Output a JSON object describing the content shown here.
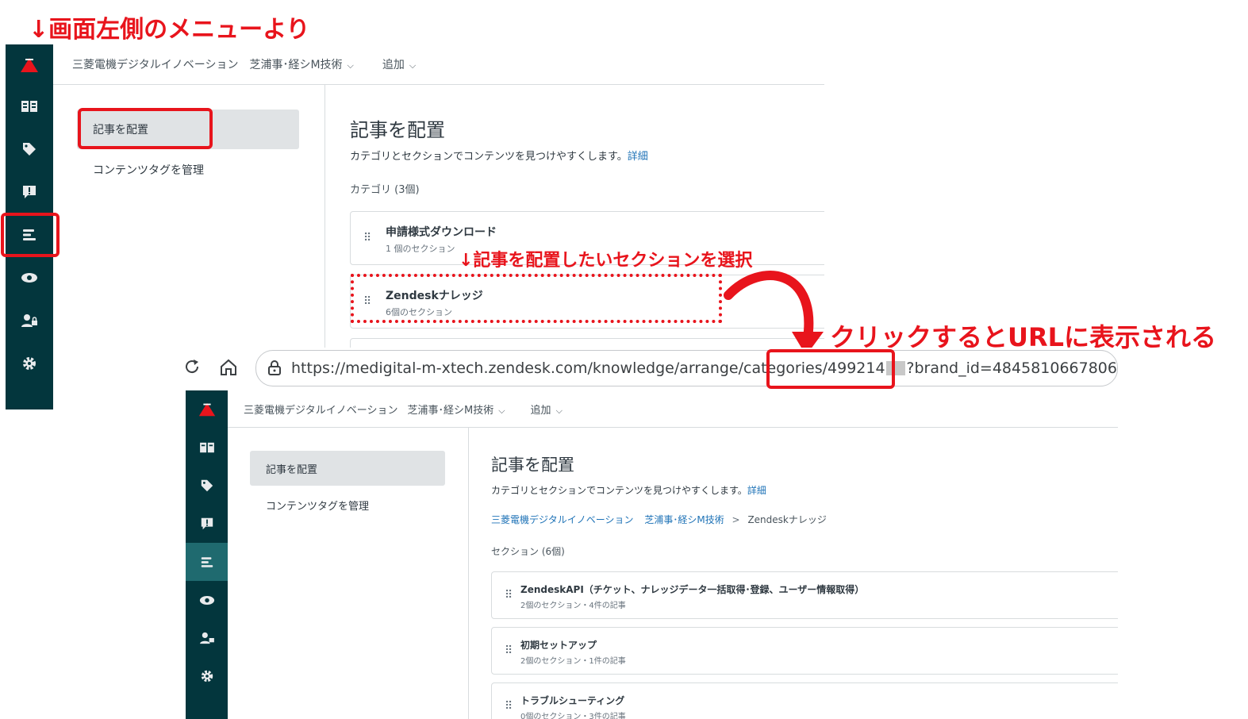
{
  "annotations": {
    "top_left": "↓画面左側のメニューより",
    "select_section": "↓記事を配置したいセクションを選択",
    "click_url": "クリックするとURLに表示される"
  },
  "header": {
    "brand": "三菱電機デジタルイノベーション",
    "workspace": "芝浦事･経シM技術",
    "add": "追加"
  },
  "sidebar_icons": [
    "knowledge-icon",
    "tag-icon",
    "feedback-icon",
    "arrange-icon",
    "eye-icon",
    "user-permissions-icon",
    "settings-icon"
  ],
  "subnav": {
    "arrange": "記事を配置",
    "tags": "コンテンツタグを管理"
  },
  "page": {
    "title": "記事を配置",
    "description": "カテゴリとセクションでコンテンツを見つけやすくします。",
    "details_link": "詳細"
  },
  "categories": {
    "label": "カテゴリ (3個)",
    "items": [
      {
        "title": "申請様式ダウンロード",
        "sub": "1 個のセクション"
      },
      {
        "title": "Zendeskナレッジ",
        "sub": "6個のセクション"
      }
    ]
  },
  "browser": {
    "url_before": "https://medigital-m-xtech.zendesk.com/knowledge/arrange/categories",
    "url_id": "/499214",
    "url_after": "?brand_id=4845810667806"
  },
  "breadcrumb": {
    "brand": "三菱電機デジタルイノベーション",
    "workspace": "芝浦事･経シM技術",
    "sep": ">",
    "current": "Zendeskナレッジ"
  },
  "sections": {
    "label": "セクション (6個)",
    "items": [
      {
        "title": "ZendeskAPI（チケット、ナレッジデータ一括取得･登録、ユーザー情報取得）",
        "sub": "2個のセクション・4件の記事"
      },
      {
        "title": "初期セットアップ",
        "sub": "2個のセクション・1件の記事"
      },
      {
        "title": "トラブルシューティング",
        "sub": "0個のセクション・3件の記事"
      }
    ]
  },
  "colors": {
    "sidebar": "#03363d",
    "sidebar_active": "#1f6a6f",
    "annotation_red": "#e8141c",
    "link_blue": "#1f73b7"
  }
}
